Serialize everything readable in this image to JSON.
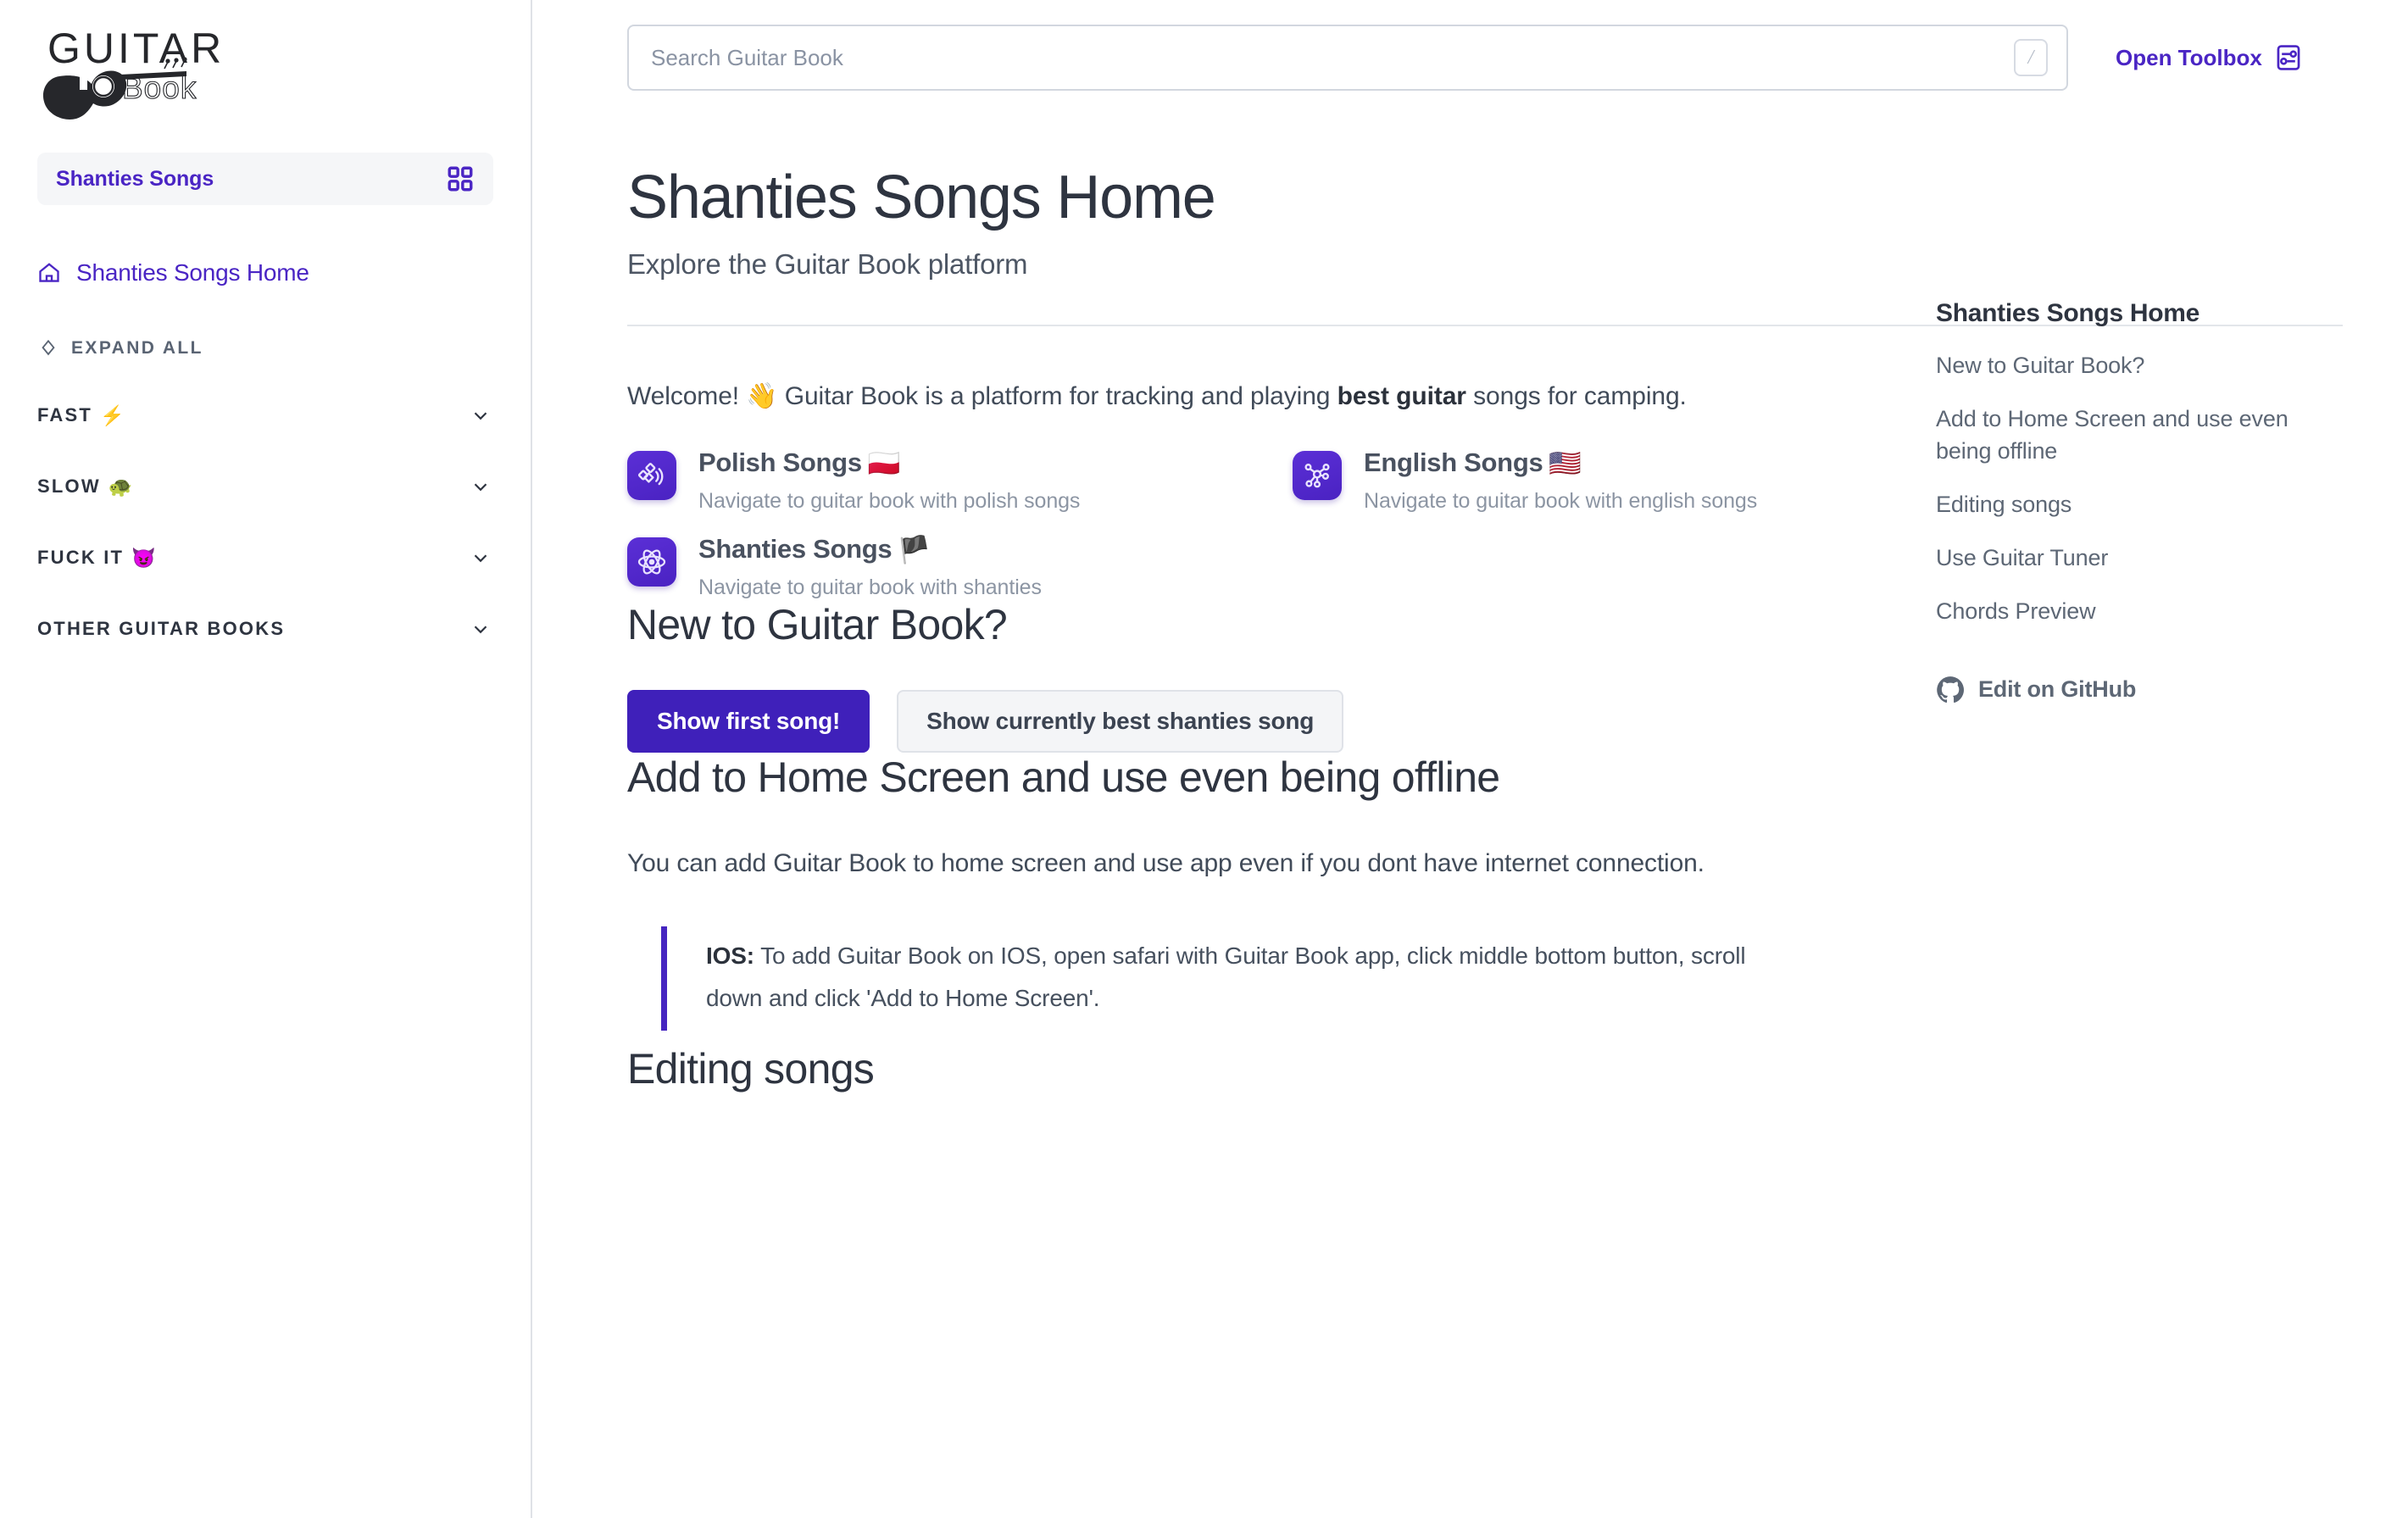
{
  "brand": {
    "logo_top": "GUITAR",
    "logo_bottom": "Book"
  },
  "sidebar": {
    "book_switcher": {
      "label": "Shanties Songs",
      "icon": "grid-icon"
    },
    "home_link": {
      "label": "Shanties Songs Home",
      "icon": "home-icon"
    },
    "expand_all": {
      "label": "EXPAND ALL",
      "icon": "expand-collapse-icon"
    },
    "groups": [
      {
        "label": "FAST",
        "emoji": "⚡",
        "icon": "chevron-down-icon"
      },
      {
        "label": "SLOW",
        "emoji": "🐢",
        "icon": "chevron-down-icon"
      },
      {
        "label": "FUCK IT",
        "emoji": "😈",
        "icon": "chevron-down-icon"
      },
      {
        "label": "OTHER GUITAR BOOKS",
        "emoji": "",
        "icon": "chevron-down-icon"
      }
    ]
  },
  "topbar": {
    "search": {
      "placeholder": "Search Guitar Book",
      "value": "",
      "kbd_hint": "/"
    },
    "toolbox": {
      "label": "Open Toolbox",
      "icon": "sliders-icon"
    }
  },
  "main": {
    "title": "Shanties Songs Home",
    "subtitle": "Explore the Guitar Book platform",
    "welcome": {
      "lead": "Welcome! 👋 Guitar Book is a platform for tracking and playing ",
      "strong": "best guitar",
      "tail": " songs for camping."
    },
    "cards": [
      {
        "title": "Polish Songs",
        "emoji": "🇵🇱",
        "desc": "Navigate to guitar book with polish songs",
        "icon": "satellite-icon"
      },
      {
        "title": "English Songs",
        "emoji": "🇺🇸",
        "desc": "Navigate to guitar book with english songs",
        "icon": "network-nodes-icon"
      },
      {
        "title": "Shanties Songs",
        "emoji": "🏴",
        "desc": "Navigate to guitar book with shanties",
        "icon": "atom-icon"
      }
    ],
    "section_new": {
      "heading": "New to Guitar Book?",
      "primary_button": "Show first song!",
      "secondary_button": "Show currently best shanties song"
    },
    "section_offline": {
      "heading": "Add to Home Screen and use even being offline",
      "paragraph": "You can add Guitar Book to home screen and use app even if you dont have internet connection.",
      "quote_label": "IOS:",
      "quote_text": " To add Guitar Book on IOS, open safari with Guitar Book app, click middle bottom button, scroll down and click 'Add to Home Screen'."
    },
    "section_editing": {
      "heading": "Editing songs"
    }
  },
  "toc": {
    "title": "Shanties Songs Home",
    "items": [
      "New to Guitar Book?",
      "Add to Home Screen and use even being offline",
      "Editing songs",
      "Use Guitar Tuner",
      "Chords Preview"
    ],
    "github": {
      "label": "Edit on GitHub",
      "icon": "github-icon"
    }
  },
  "colors": {
    "accent": "#4a25c4",
    "primary_button": "#3f20ba",
    "text": "#2e3440",
    "muted": "#8c95a3",
    "border": "#dfe2e7"
  }
}
